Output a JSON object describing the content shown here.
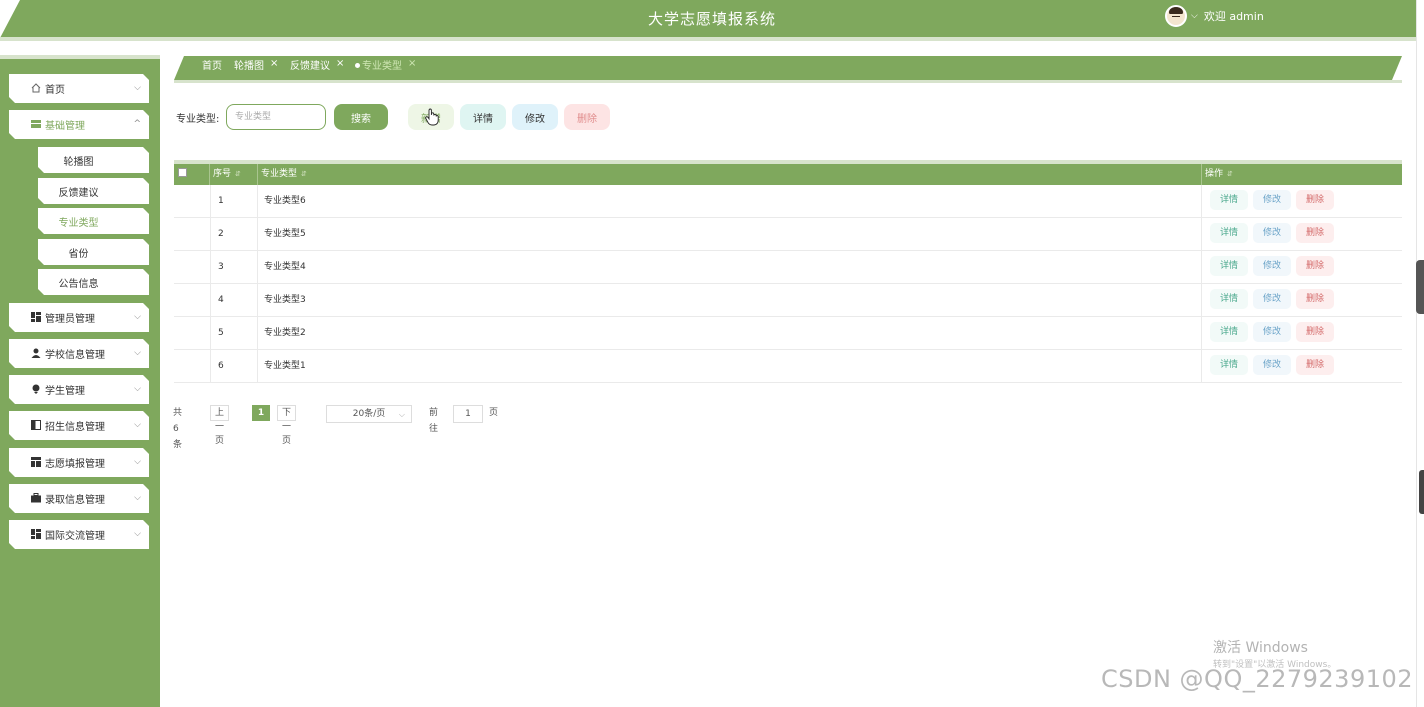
{
  "header": {
    "title": "大学志愿填报系统",
    "welcome": "欢迎 admin"
  },
  "sidebar": {
    "items": [
      {
        "label": "首页",
        "icon": "home-icon"
      },
      {
        "label": "基础管理",
        "icon": "grid-icon",
        "active": true
      },
      {
        "label": "管理员管理",
        "icon": "dashboard-icon"
      },
      {
        "label": "学校信息管理",
        "icon": "user-icon"
      },
      {
        "label": "学生管理",
        "icon": "student-icon"
      },
      {
        "label": "招生信息管理",
        "icon": "book-icon"
      },
      {
        "label": "志愿填报管理",
        "icon": "table-icon"
      },
      {
        "label": "录取信息管理",
        "icon": "briefcase-icon"
      },
      {
        "label": "国际交流管理",
        "icon": "dashboard-icon"
      }
    ],
    "subitems": [
      {
        "label": "轮播图"
      },
      {
        "label": "反馈建议"
      },
      {
        "label": "专业类型",
        "active": true
      },
      {
        "label": "省份"
      },
      {
        "label": "公告信息"
      }
    ]
  },
  "tabs": [
    {
      "label": "首页"
    },
    {
      "label": "轮播图"
    },
    {
      "label": "反馈建议"
    },
    {
      "label": "专业类型",
      "active": true
    }
  ],
  "search": {
    "label": "专业类型:",
    "placeholder": "专业类型",
    "search_btn": "搜索",
    "add_btn": "新增",
    "detail_btn": "详情",
    "edit_btn": "修改",
    "delete_btn": "删除"
  },
  "table": {
    "headers": {
      "index": "序号",
      "type": "专业类型",
      "action": "操作"
    },
    "rows": [
      {
        "index": "1",
        "type": "专业类型6"
      },
      {
        "index": "2",
        "type": "专业类型5"
      },
      {
        "index": "3",
        "type": "专业类型4"
      },
      {
        "index": "4",
        "type": "专业类型3"
      },
      {
        "index": "5",
        "type": "专业类型2"
      },
      {
        "index": "6",
        "type": "专业类型1"
      }
    ],
    "row_actions": {
      "detail": "详情",
      "edit": "修改",
      "delete": "删除"
    }
  },
  "pagination": {
    "total": "共 6 条",
    "prev": "上一页",
    "current": "1",
    "next": "下一页",
    "page_size": "20条/页",
    "goto": "前往",
    "goto_value": "1",
    "page_unit": "页"
  },
  "watermarks": {
    "windows": "激活 Windows",
    "windows_sub": "转到\"设置\"以激活 Windows。",
    "csdn": "CSDN @QQ_2279239102"
  },
  "colors": {
    "primary": "#7fa85d",
    "light": "#d7e3cc"
  }
}
